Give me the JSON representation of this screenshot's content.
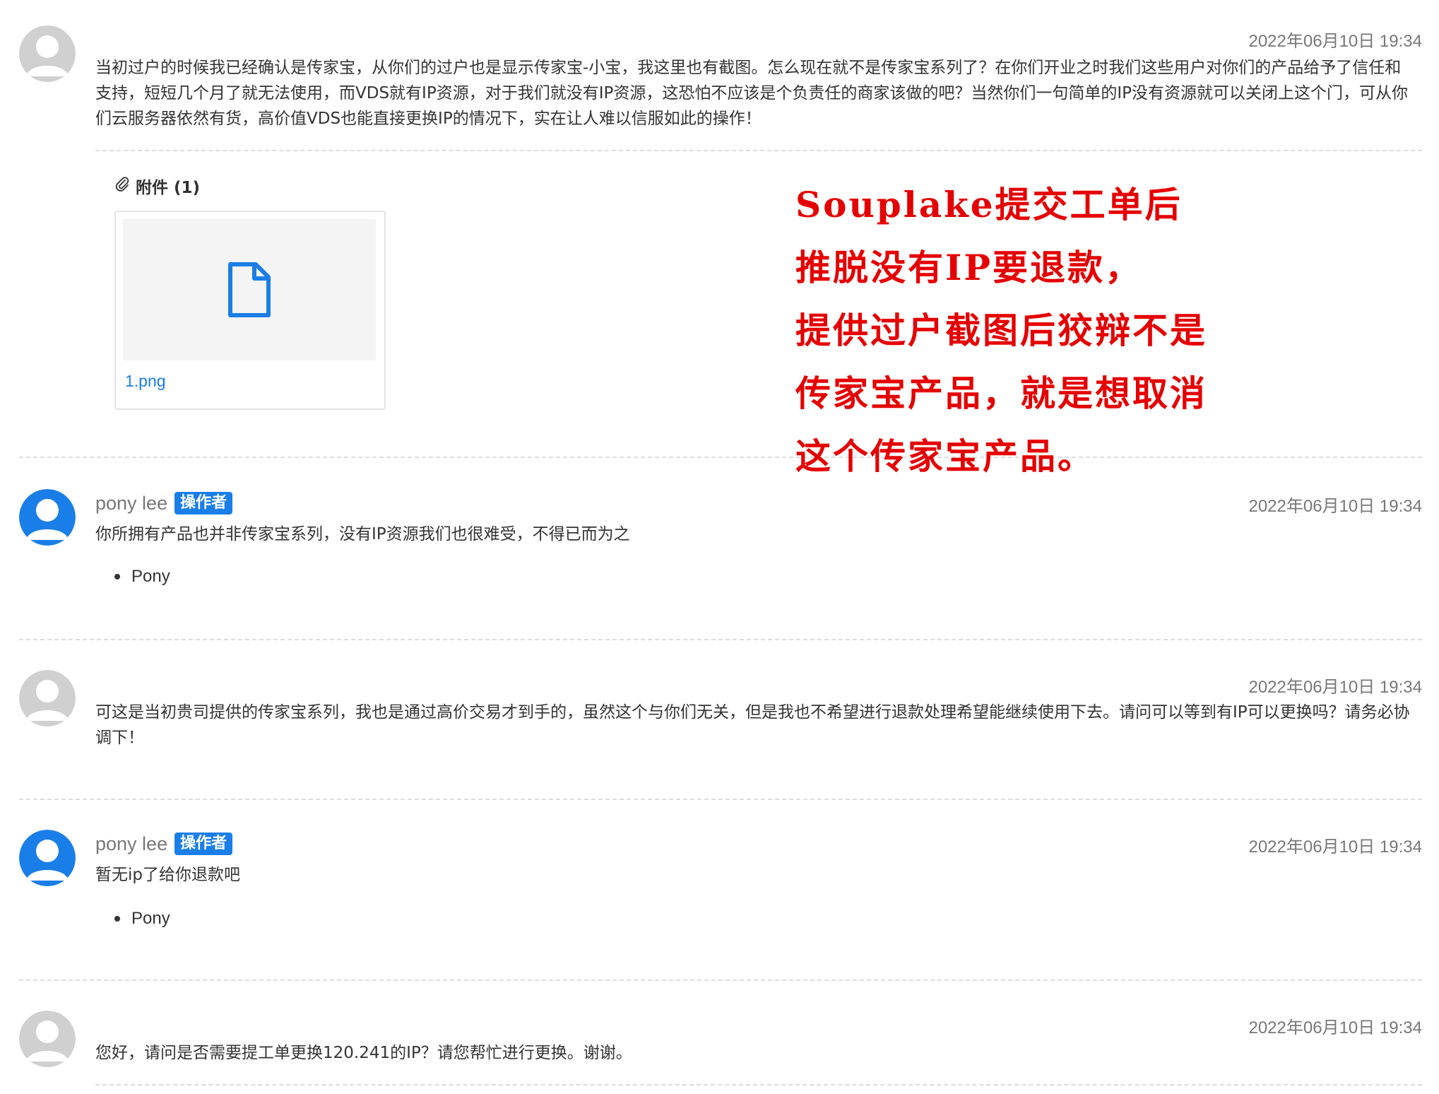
{
  "replies": [
    {
      "author": "",
      "badge": "",
      "timestamp": "2022年06月10日 19:34",
      "message": "当初过户的时候我已经确认是传家宝，从你们的过户也是显示传家宝-小宝，我这里也有截图。怎么现在就不是传家宝系列了？在你们开业之时我们这些用户对你们的产品给予了信任和支持，短短几个月了就无法使用，而VDS就有IP资源，对于我们就没有IP资源，这恐怕不应该是个负责任的商家该做的吧？当然你们一句简单的IP没有资源就可以关闭上这个门，可从你们云服务器依然有货，高价值VDS也能直接更换IP的情况下，实在让人难以信服如此的操作！",
      "attachments_title": "附件 (1)",
      "attachment_name": "1.png"
    },
    {
      "author": "pony lee",
      "badge": "操作者",
      "timestamp": "2022年06月10日 19:34",
      "message": "你所拥有产品也并非传家宝系列，没有IP资源我们也很难受，不得已而为之",
      "signature": "Pony"
    },
    {
      "author": "",
      "timestamp": "2022年06月10日 19:34",
      "message": "可这是当初贵司提供的传家宝系列，我也是通过高价交易才到手的，虽然这个与你们无关，但是我也不希望进行退款处理希望能继续使用下去。请问可以等到有IP可以更换吗？请务必协调下！"
    },
    {
      "author": "pony lee",
      "badge": "操作者",
      "timestamp": "2022年06月10日 19:34",
      "message": "暂无ip了给你退款吧",
      "signature": "Pony"
    },
    {
      "author": "",
      "timestamp": "2022年06月10日 19:34",
      "message": "您好，请问是否需要提工单更换120.241的IP？请您帮忙进行更换。谢谢。"
    }
  ],
  "annotation": {
    "color": "#e50000",
    "lines": [
      "Souplake提交工单后",
      "推脱没有IP要退款，",
      "提供过户截图后狡辩不是",
      "传家宝产品，就是想取消",
      "这个传家宝产品。"
    ]
  },
  "colors": {
    "staff_avatar": "#1a7ee8",
    "client_avatar": "#d0d0d0",
    "link": "#1a7ee8"
  },
  "icons": {
    "attachment": "paperclip-icon",
    "file": "file-icon",
    "staff_avatar": "user-avatar-blue",
    "client_avatar": "user-avatar-gray"
  }
}
